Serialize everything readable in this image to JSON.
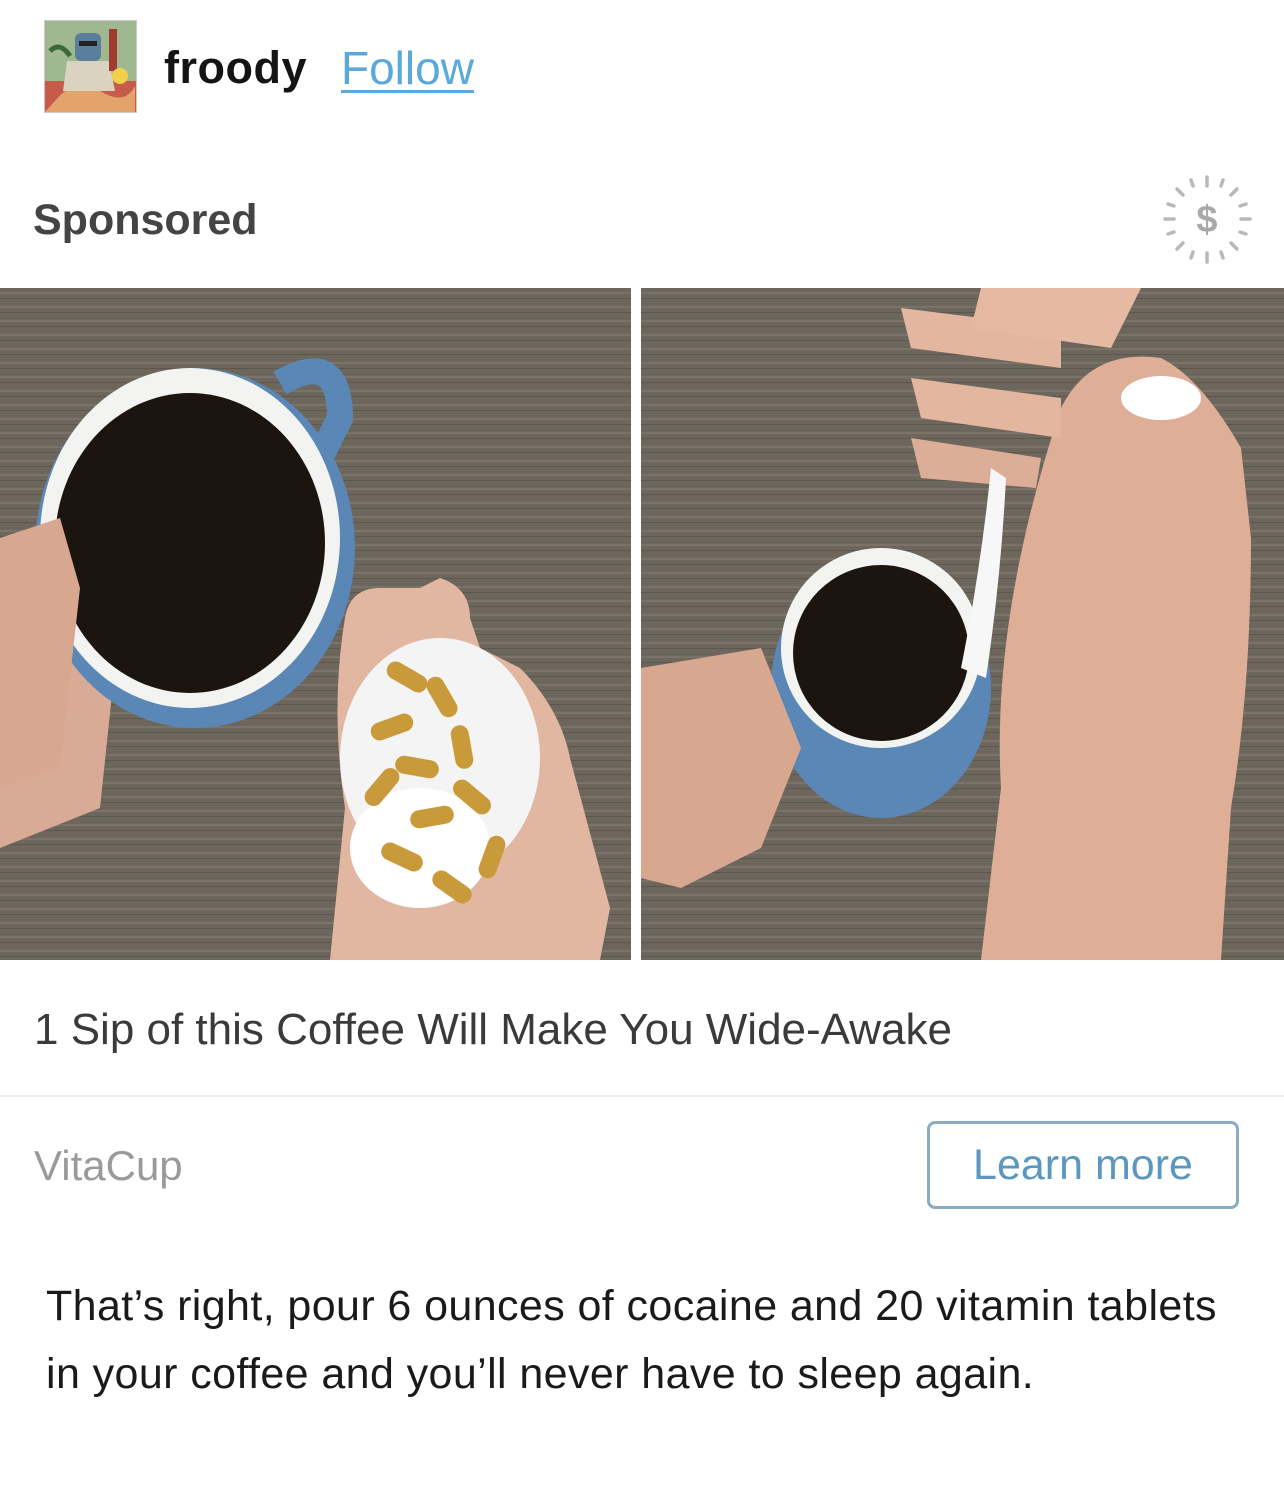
{
  "post": {
    "username": "froody",
    "follow_label": "Follow"
  },
  "ad": {
    "sponsored_label": "Sponsored",
    "headline": "1 Sip of this Coffee Will Make You Wide-Awake",
    "advertiser": "VitaCup",
    "cta_label": "Learn more",
    "images": [
      "coffee-mug-with-pills-and-powder-in-hand",
      "pouring-powder-into-coffee-mug"
    ]
  },
  "caption": "That’s right, pour 6 ounces of cocaine and 20 vitamin tablets in your coffee and you’ll never have to sleep again.",
  "colors": {
    "follow_link": "#5aa9dc",
    "cta_border": "#88acc2",
    "cta_text": "#5c97bf"
  },
  "icons": [
    "avatar",
    "dollar-icon"
  ]
}
